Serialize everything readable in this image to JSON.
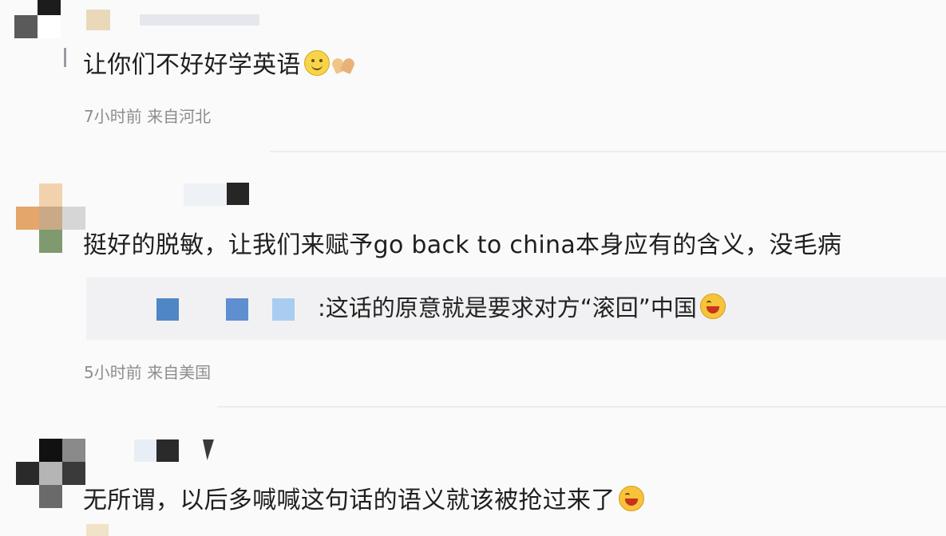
{
  "comments": [
    {
      "text": "让你们不好好学英语",
      "meta": "7小时前 来自河北",
      "emojis": [
        "smile-icon",
        "clapping-hands-icon"
      ]
    },
    {
      "text": "挺好的脱敏，让我们来赋予go back to china本身应有的含义，没毛病",
      "meta": "5小时前 来自美国",
      "reply": {
        "text": ":这话的原意就是要求对方“滚回”中国",
        "emoji": "laughing-icon"
      }
    },
    {
      "text": "无所谓，以后多喊喊这句话的语义就该被抢过来了",
      "emojis": [
        "grinning-sweat-icon"
      ]
    }
  ],
  "colors": {
    "background": "#fafafb",
    "meta_text": "#8d8d8d",
    "reply_background": "#f1f1f3"
  }
}
